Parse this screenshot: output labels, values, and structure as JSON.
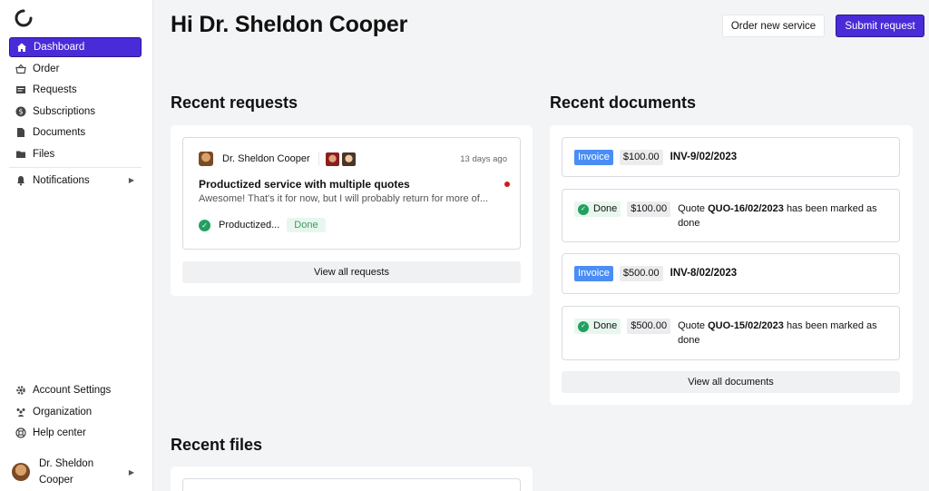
{
  "sidebar": {
    "nav": [
      {
        "label": "Dashboard",
        "icon": "home-icon"
      },
      {
        "label": "Order",
        "icon": "basket-icon"
      },
      {
        "label": "Requests",
        "icon": "requests-icon"
      },
      {
        "label": "Subscriptions",
        "icon": "dollar-icon"
      },
      {
        "label": "Documents",
        "icon": "document-icon"
      },
      {
        "label": "Files",
        "icon": "folder-icon"
      }
    ],
    "notifications": "Notifications",
    "bottom": [
      {
        "label": "Account Settings",
        "icon": "gear-icon"
      },
      {
        "label": "Organization",
        "icon": "people-icon"
      },
      {
        "label": "Help center",
        "icon": "lifebuoy-icon"
      }
    ],
    "profile_name": "Dr. Sheldon Cooper"
  },
  "header": {
    "greeting": "Hi Dr. Sheldon Cooper",
    "order_label": "Order new service",
    "submit_label": "Submit request"
  },
  "requests": {
    "title": "Recent requests",
    "item": {
      "author": "Dr. Sheldon Cooper",
      "time": "13 days ago",
      "title": "Productized service with multiple quotes",
      "snippet": "Awesome! That's it for now, but I will probably return for more of...",
      "service": "Productized...",
      "status": "Done"
    },
    "view_all": "View all requests"
  },
  "documents": {
    "title": "Recent documents",
    "items": [
      {
        "tag": "Invoice",
        "amount": "$100.00",
        "number": "INV-9/02/2023"
      },
      {
        "tag": "Done",
        "amount": "$100.00",
        "prefix": "Quote",
        "number": "QUO-16/02/2023",
        "suffix": "has been marked as done"
      },
      {
        "tag": "Invoice",
        "amount": "$500.00",
        "number": "INV-8/02/2023"
      },
      {
        "tag": "Done",
        "amount": "$500.00",
        "prefix": "Quote",
        "number": "QUO-15/02/2023",
        "suffix": "has been marked as done"
      }
    ],
    "view_all": "View all documents"
  },
  "files": {
    "title": "Recent files"
  },
  "colors": {
    "accent": "#4a2bd8",
    "invoice": "#4a8ef5",
    "done_bg": "#e8f7ee",
    "done_text": "#3d9a63",
    "unread_dot": "#d11a1a"
  }
}
